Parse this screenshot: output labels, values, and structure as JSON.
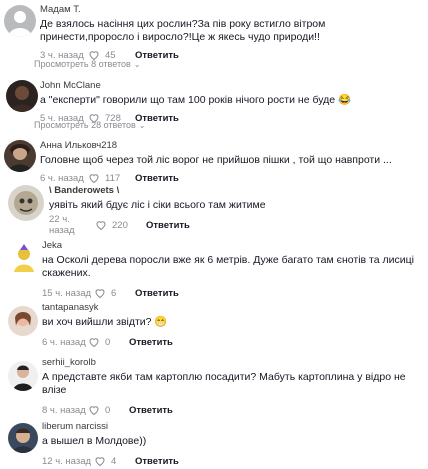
{
  "comments": [
    {
      "username": "Мадам Т.",
      "text": "Де взялось насіння цих рослин?За пів року встигло вітром принести,проросло і виросло?!Це ж якесь чудо природи!!",
      "time": "3 ч. назад",
      "likes": "45",
      "reply": "Ответить",
      "view_replies": "Просмотреть 8 ответов"
    },
    {
      "username": "John McClane",
      "text": "а \"експерти\" говорили що там 100 років нічого рости не буде 😂",
      "time": "5 ч. назад",
      "likes": "728",
      "reply": "Ответить",
      "view_replies": "Просмотреть 28 ответов"
    },
    {
      "username": "Анна Ильковч218",
      "text": "Головне щоб через той ліс ворог не прийшов пішки , той що навпроти ...",
      "time": "6 ч. назад",
      "likes": "117",
      "reply": "Ответить"
    },
    {
      "username": "\\ Banderowets \\",
      "text": "уявіть який бдує ліс і сіки всього там житиме",
      "time": "22 ч. назад",
      "likes": "220",
      "reply": "Ответить"
    },
    {
      "username": "Jeka",
      "text": "на Осколі дерева поросли вже як 6 метрів. Дуже багато там єнотів та лисиці скажених.",
      "time": "15 ч. назад",
      "likes": "6",
      "reply": "Ответить"
    },
    {
      "username": "tantapanasyk",
      "text": "ви хоч вийшли звідти? 😁",
      "time": "6 ч. назад",
      "likes": "0",
      "reply": "Ответить"
    },
    {
      "username": "serhii_korolb",
      "text": "А представте якби там картоплю посадити? Мабуть картоплина у відро не влізе",
      "time": "8 ч. назад",
      "likes": "0",
      "reply": "Ответить"
    },
    {
      "username": "liberum narcissi",
      "text": "а вышел в Молдове))",
      "time": "12 ч. назад",
      "likes": "4",
      "reply": "Ответить"
    }
  ],
  "icons": {
    "heart": "heart-outline-icon",
    "chevron": "chevron-down-icon"
  },
  "colors": {
    "text": "#161823",
    "meta": "#8a8b91",
    "background": "#ffffff"
  }
}
